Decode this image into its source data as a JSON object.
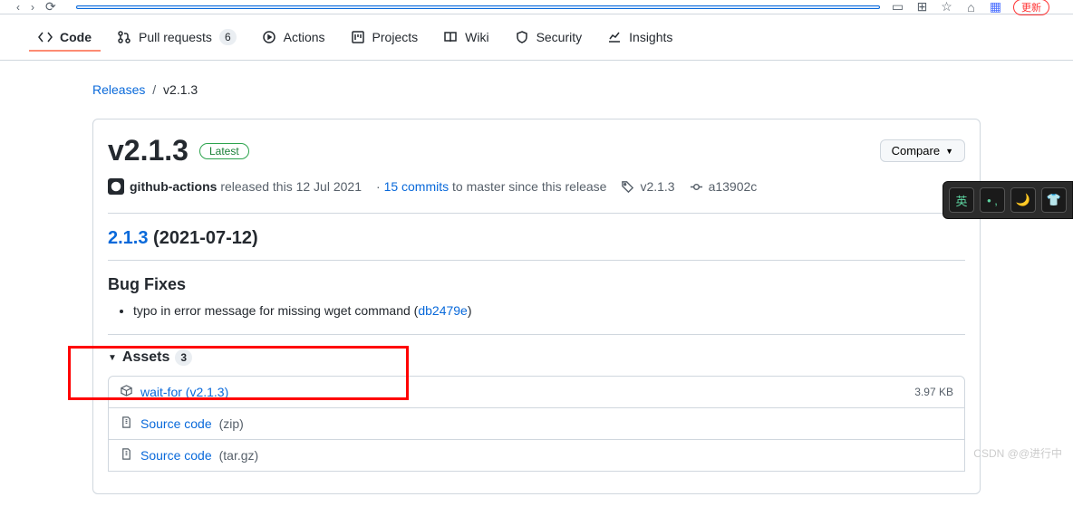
{
  "topright_badge": "更新",
  "tabs": {
    "code": "Code",
    "pulls": "Pull requests",
    "pulls_count": "6",
    "actions": "Actions",
    "projects": "Projects",
    "wiki": "Wiki",
    "security": "Security",
    "insights": "Insights"
  },
  "breadcrumb": {
    "releases": "Releases",
    "current": "v2.1.3"
  },
  "release": {
    "title": "v2.1.3",
    "latest": "Latest",
    "compare": "Compare",
    "author": "github-actions",
    "released_text": " released this 12 Jul 2021",
    "commits_count": "15 commits",
    "commits_suffix": " to master since this release",
    "tag": "v2.1.3",
    "sha": "a13902c"
  },
  "changelog": {
    "version_link": "2.1.3",
    "date": " (2021-07-12)",
    "bugfixes_heading": "Bug Fixes",
    "fix_text": "typo in error message for missing wget command (",
    "fix_sha": "db2479e",
    "fix_suffix": ")"
  },
  "assets": {
    "heading": "Assets",
    "count": "3",
    "items": [
      {
        "name": "wait-for (v2.1.3)",
        "ext": "",
        "size": "3.97 KB",
        "icon": "package"
      },
      {
        "name": "Source code",
        "ext": "(zip)",
        "size": "",
        "icon": "zip"
      },
      {
        "name": "Source code",
        "ext": "(tar.gz)",
        "size": "",
        "icon": "zip"
      }
    ]
  },
  "ime": [
    "英",
    "• ,",
    "🌙",
    "👕"
  ],
  "watermark": "CSDN @@进行中"
}
